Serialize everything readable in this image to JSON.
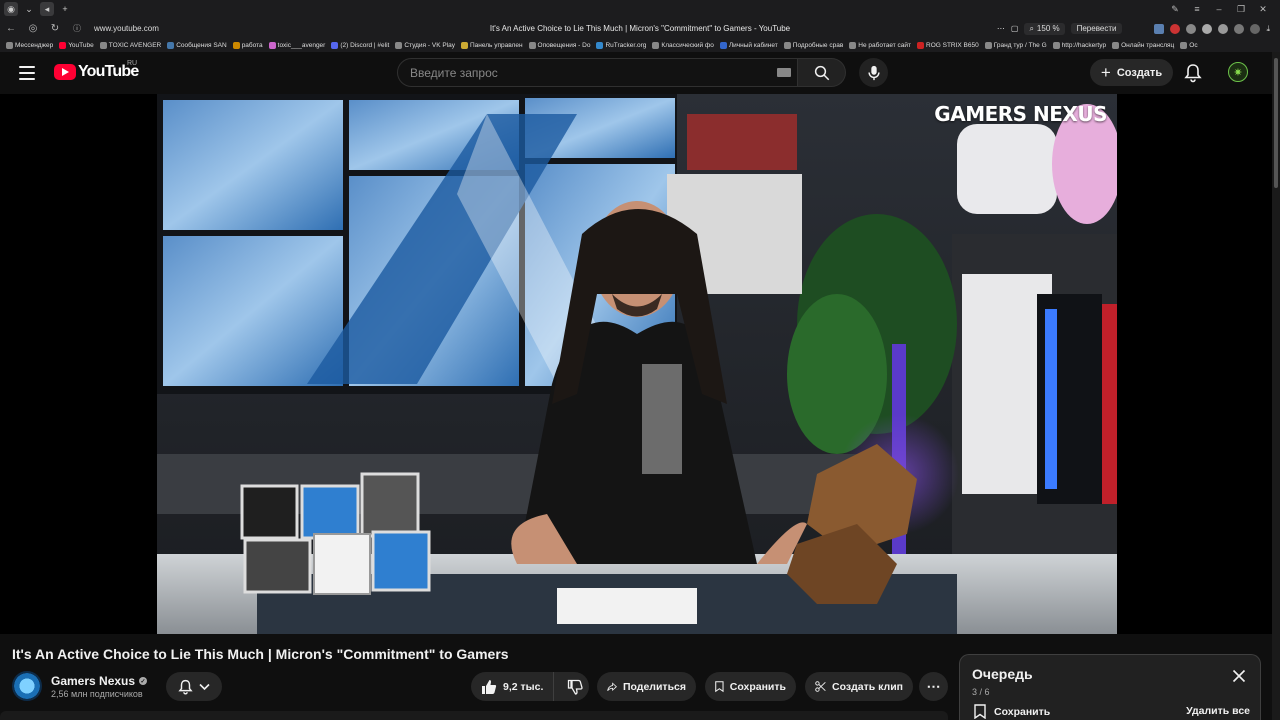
{
  "browser": {
    "url": "www.youtube.com",
    "page_title": "It's An Active Choice to Lie This Much | Micron's \"Commitment\" to Gamers - YouTube",
    "zoom": "150 %",
    "translate_label": "Перевести",
    "bookmarks": [
      "Мессенджер",
      "YouTube",
      "TOXIC AVENGER",
      "Сообщения SAN",
      "работа",
      "toxic___avenger",
      "(2) Discord | #elit",
      "Студия - VK Play",
      "Панель управлен",
      "Оповещения - Do",
      "RuTracker.org",
      "Классический фо",
      "Личный кабинет",
      "Подробные срав",
      "Не работает сайт",
      "ROG STRIX B650",
      "Гранд тур / The G",
      "http://hackertyp",
      "Онлайн трансляц",
      "Oc"
    ]
  },
  "header": {
    "logo_text": "YouTube",
    "region": "RU",
    "search_placeholder": "Введите запрос",
    "create_label": "Создать"
  },
  "video": {
    "watermark": "GAMERS NEXUS",
    "title": "It's An Active Choice to Lie This Much | Micron's \"Commitment\" to Gamers"
  },
  "channel": {
    "name": "Gamers Nexus",
    "subscribers": "2,56 млн подписчиков"
  },
  "actions": {
    "likes": "9,2 тыс.",
    "share": "Поделиться",
    "save": "Сохранить",
    "clip": "Создать клип",
    "more": "⋯"
  },
  "queue": {
    "title": "Очередь",
    "count": "3 / 6",
    "save": "Сохранить",
    "delete_all": "Удалить все"
  },
  "colors": {
    "background": "#0f0f0f",
    "brand_red": "#ff0033",
    "pill": "#272727",
    "text_secondary": "#aaaaaa"
  }
}
